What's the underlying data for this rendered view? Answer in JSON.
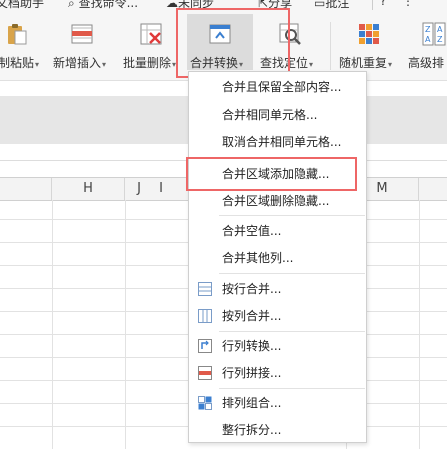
{
  "topbar": {
    "items": [
      "文档助手",
      "查找命令...",
      "未同步",
      "分享",
      "批注"
    ]
  },
  "ribbon": {
    "buttons": [
      {
        "label": "制粘贴",
        "caret": "▾"
      },
      {
        "label": "新增插入",
        "caret": "▾"
      },
      {
        "label": "批量删除",
        "caret": "▾"
      },
      {
        "label": "合并转换",
        "caret": "▾"
      },
      {
        "label": "查找定位",
        "caret": "▾"
      },
      {
        "label": "随机重复",
        "caret": "▾"
      },
      {
        "label": "高级排"
      }
    ]
  },
  "grid": {
    "columns": [
      "H",
      "I",
      "J",
      "M"
    ]
  },
  "menu": {
    "items": [
      "合并且保留全部内容...",
      "合并相同单元格...",
      "取消合并相同单元格...",
      "合并区域添加隐藏...",
      "合并区域删除隐藏...",
      "合并空值...",
      "合并其他列...",
      "按行合并...",
      "按列合并...",
      "行列转换...",
      "行列拼接...",
      "排列组合...",
      "整行拆分..."
    ]
  },
  "colors": {
    "highlight": "#e66666",
    "ribbon_bg": "#f6f6f6",
    "accent_blue": "#3b7fd0"
  }
}
